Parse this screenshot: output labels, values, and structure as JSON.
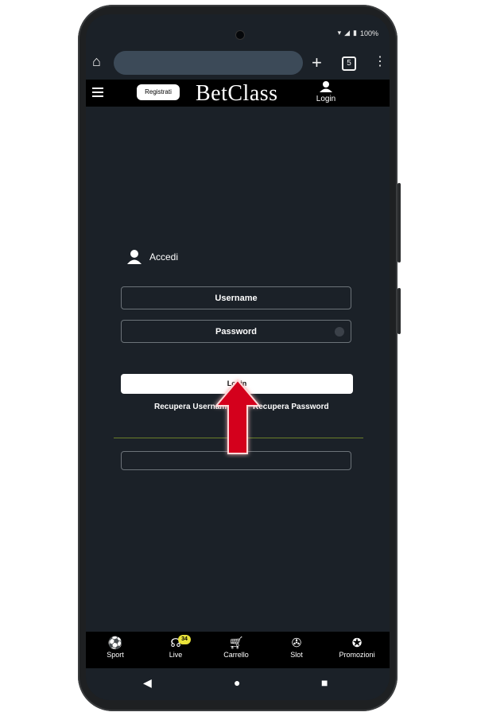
{
  "status": {
    "battery": "100%"
  },
  "browser": {
    "tab_count": "5"
  },
  "site": {
    "register_label": "Registrati",
    "logo": "BetClass",
    "login_label": "Login"
  },
  "form": {
    "heading": "Accedi",
    "username_placeholder": "Username",
    "password_placeholder": "Password",
    "login_button": "Login",
    "recover_username": "Recupera Username",
    "recover_password": "Recupera Password"
  },
  "bottom_nav": {
    "items": [
      {
        "label": "Sport",
        "icon": "soccer-ball-icon"
      },
      {
        "label": "Live",
        "icon": "antenna-icon",
        "badge": "34"
      },
      {
        "label": "Carrello",
        "icon": "cart-icon"
      },
      {
        "label": "Slot",
        "icon": "reel-icon"
      },
      {
        "label": "Promozioni",
        "icon": "award-icon"
      }
    ]
  },
  "colors": {
    "site_bar": "#000000",
    "page_bg": "#1b2128",
    "accent_arrow": "#e0001a",
    "badge": "#e8e23a"
  }
}
